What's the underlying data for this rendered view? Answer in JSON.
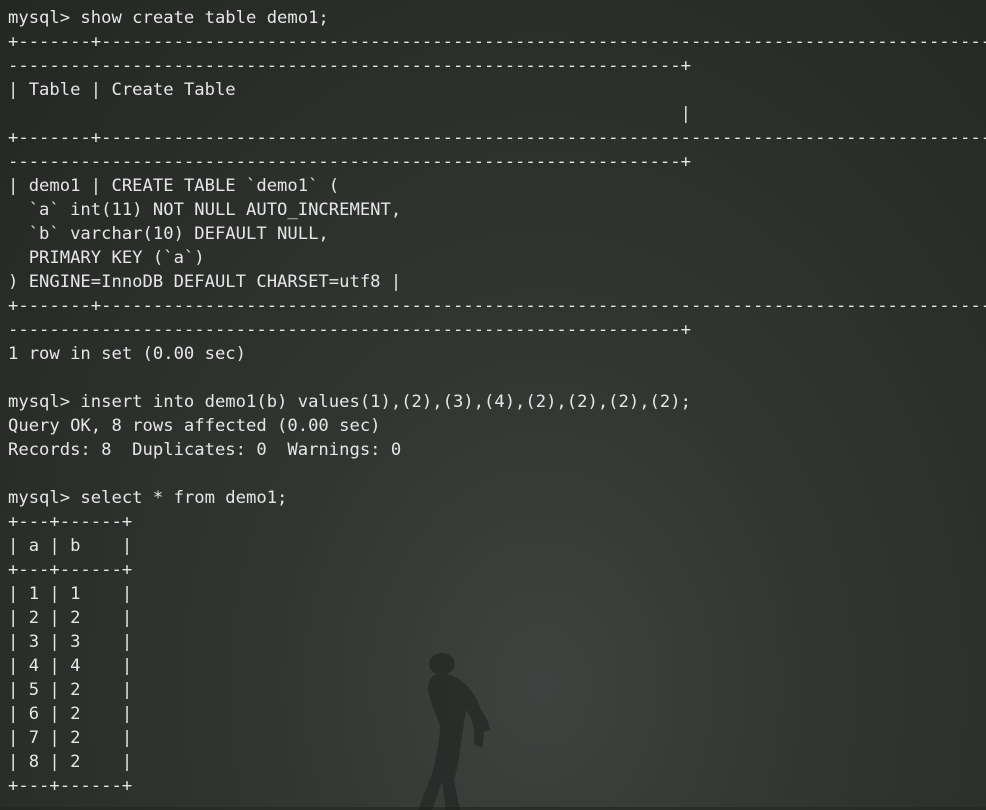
{
  "terminal": {
    "lines": [
      "mysql> show create table demo1;",
      "+-------+------------------------------------------------------------------------------------------------------------------------------------------------",
      "-----------------------------------------------------------------+",
      "| Table | Create Table",
      "                                                                 |",
      "+-------+------------------------------------------------------------------------------------------------------------------------------------------------",
      "-----------------------------------------------------------------+",
      "| demo1 | CREATE TABLE `demo1` (",
      "  `a` int(11) NOT NULL AUTO_INCREMENT,",
      "  `b` varchar(10) DEFAULT NULL,",
      "  PRIMARY KEY (`a`)",
      ") ENGINE=InnoDB DEFAULT CHARSET=utf8 |",
      "+-------+------------------------------------------------------------------------------------------------------------------------------------------------",
      "-----------------------------------------------------------------+",
      "1 row in set (0.00 sec)",
      "",
      "mysql> insert into demo1(b) values(1),(2),(3),(4),(2),(2),(2),(2);",
      "Query OK, 8 rows affected (0.00 sec)",
      "Records: 8  Duplicates: 0  Warnings: 0",
      "",
      "mysql> select * from demo1;",
      "+---+------+",
      "| a | b    |",
      "+---+------+",
      "| 1 | 1    |",
      "| 2 | 2    |",
      "| 3 | 3    |",
      "| 4 | 4    |",
      "| 5 | 2    |",
      "| 6 | 2    |",
      "| 7 | 2    |",
      "| 8 | 2    |",
      "+---+------+"
    ]
  },
  "colors": {
    "text": "#e6e6e6",
    "background": "#2b2e2b"
  },
  "icons": {
    "background_figure": "walking-person-silhouette"
  }
}
